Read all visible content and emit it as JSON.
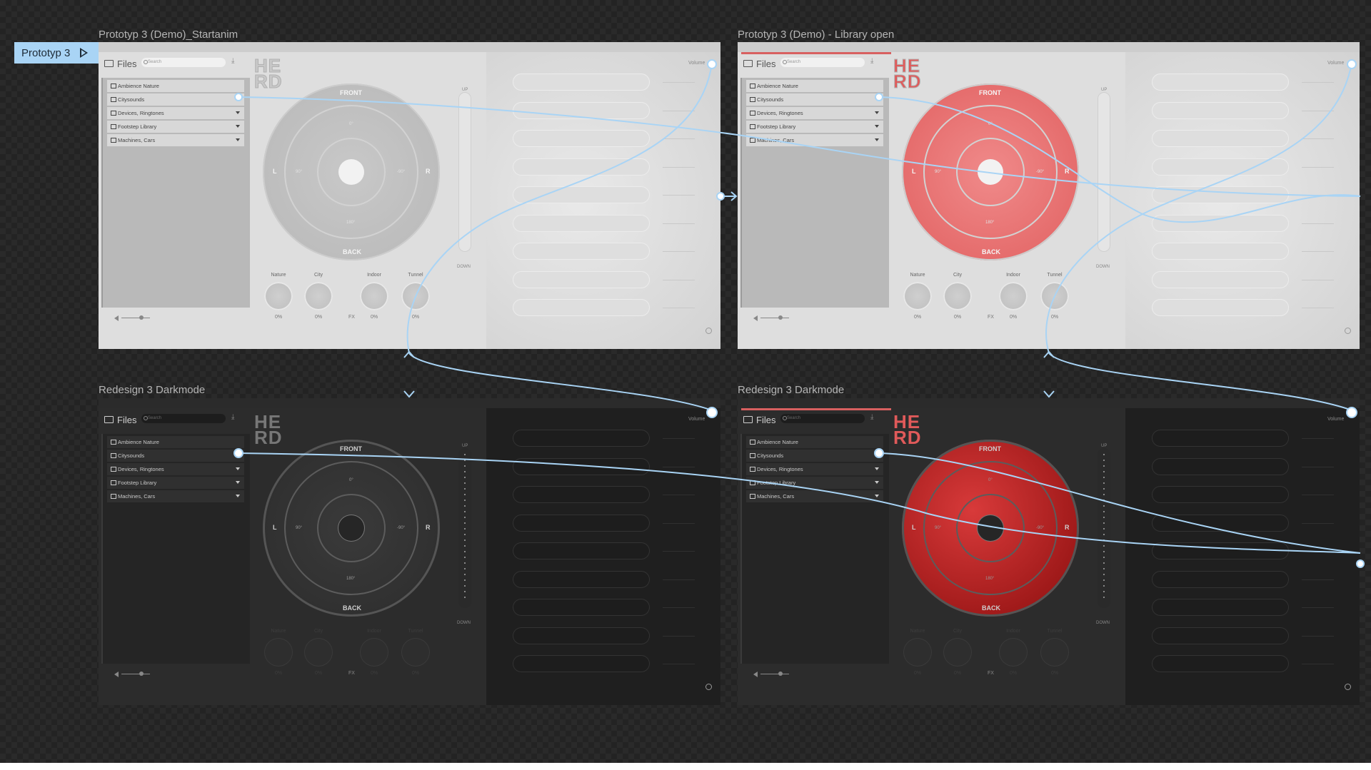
{
  "prototype_chip": {
    "label": "Prototyp 3"
  },
  "frames": [
    {
      "title": "Prototyp 3 (Demo)_Startanim",
      "files_label": "Files",
      "search_placeholder": "Search",
      "logo_line1": "HE",
      "logo_line2": "RD",
      "library": [
        "Ambience Nature",
        "Citysounds",
        "Devices, Ringtones",
        "Footstep Library",
        "Machines, Cars"
      ],
      "disc_labels": {
        "front": "FRONT",
        "back": "BACK",
        "left": "L",
        "right": "R",
        "deg0": "0°",
        "deg90": "90°",
        "degm90": "-90°",
        "deg180": "180°"
      },
      "fader": {
        "up": "UP",
        "down": "DOWN"
      },
      "knobs": [
        {
          "label": "Nature",
          "value": "0%"
        },
        {
          "label": "City",
          "value": "0%"
        },
        {
          "label": "Indoor",
          "value": "0%"
        },
        {
          "label": "Tunnel",
          "value": "0%"
        }
      ],
      "fx_label": "FX",
      "volume_label": "Volume"
    },
    {
      "title": "Prototyp 3 (Demo) - Library open",
      "files_label": "Files",
      "search_placeholder": "Search",
      "logo_line1": "HE",
      "logo_line2": "RD",
      "library": [
        "Ambience Nature",
        "Citysounds",
        "Devices, Ringtones",
        "Footstep Library",
        "Machines, Cars"
      ],
      "disc_labels": {
        "front": "FRONT",
        "back": "BACK",
        "left": "L",
        "right": "R",
        "deg0": "0°",
        "deg90": "90°",
        "degm90": "-90°",
        "deg180": "180°"
      },
      "fader": {
        "up": "UP",
        "down": "DOWN"
      },
      "knobs": [
        {
          "label": "Nature",
          "value": "0%"
        },
        {
          "label": "City",
          "value": "0%"
        },
        {
          "label": "Indoor",
          "value": "0%"
        },
        {
          "label": "Tunnel",
          "value": "0%"
        }
      ],
      "fx_label": "FX",
      "volume_label": "Volume"
    },
    {
      "title": "Redesign 3 Darkmode",
      "files_label": "Files",
      "search_placeholder": "Search",
      "logo_line1": "HE",
      "logo_line2": "RD",
      "library": [
        "Ambience Nature",
        "Citysounds",
        "Devices, Ringtones",
        "Footstep Library",
        "Machines, Cars"
      ],
      "disc_labels": {
        "front": "FRONT",
        "back": "BACK",
        "left": "L",
        "right": "R",
        "deg0": "0°",
        "deg90": "90°",
        "degm90": "-90°",
        "deg180": "180°"
      },
      "fader": {
        "up": "UP",
        "down": "DOWN"
      },
      "knobs": [
        {
          "label": "Nature",
          "value": "0%"
        },
        {
          "label": "City",
          "value": "0%"
        },
        {
          "label": "Indoor",
          "value": "0%"
        },
        {
          "label": "Tunnel",
          "value": "0%"
        }
      ],
      "fx_label": "FX",
      "volume_label": "Volume"
    },
    {
      "title": "Redesign 3 Darkmode",
      "files_label": "Files",
      "search_placeholder": "Search",
      "logo_line1": "HE",
      "logo_line2": "RD",
      "library": [
        "Ambience Nature",
        "Citysounds",
        "Devices, Ringtones",
        "Footstep Library",
        "Machines, Cars"
      ],
      "disc_labels": {
        "front": "FRONT",
        "back": "BACK",
        "left": "L",
        "right": "R",
        "deg0": "0°",
        "deg90": "90°",
        "degm90": "-90°",
        "deg180": "180°"
      },
      "fader": {
        "up": "UP",
        "down": "DOWN"
      },
      "knobs": [
        {
          "label": "Nature",
          "value": "0%"
        },
        {
          "label": "City",
          "value": "0%"
        },
        {
          "label": "Indoor",
          "value": "0%"
        },
        {
          "label": "Tunnel",
          "value": "0%"
        }
      ],
      "fx_label": "FX",
      "volume_label": "Volume"
    }
  ],
  "colors": {
    "connector": "#a9d4f5",
    "accent_red": "#e05a5a",
    "canvas": "#2a2a2a"
  }
}
